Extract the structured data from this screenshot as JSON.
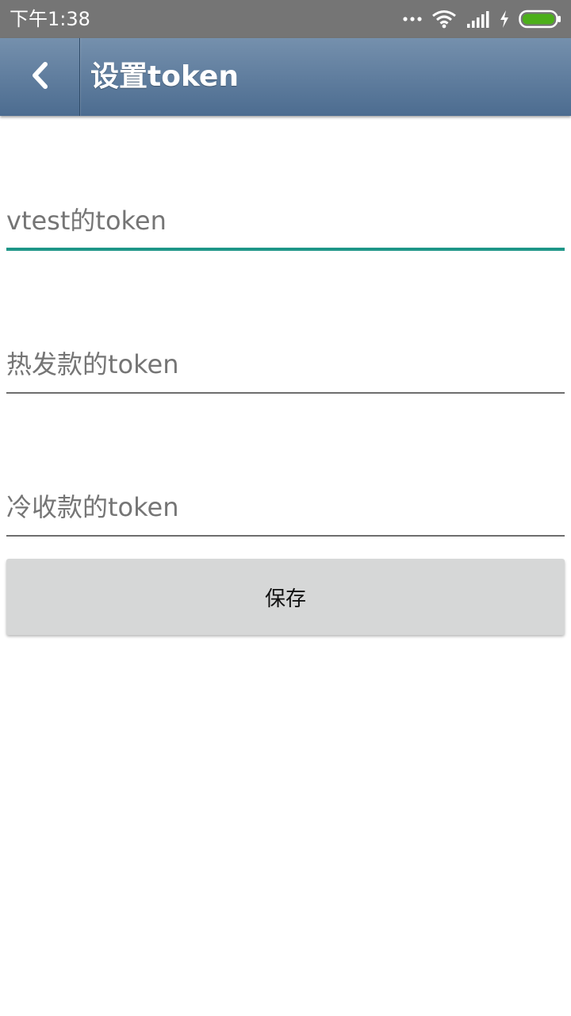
{
  "status_bar": {
    "time": "下午1:38",
    "icons": [
      "more-dots-icon",
      "wifi-icon",
      "signal-icon",
      "charging-icon",
      "battery-icon"
    ],
    "battery_color": "#4caf1a"
  },
  "app_bar": {
    "title": "设置token",
    "back_icon": "chevron-left-icon",
    "colors": {
      "top": "#7590ad",
      "bottom": "#4c6c90"
    }
  },
  "form": {
    "fields": [
      {
        "placeholder": "vtest的token",
        "value": "",
        "focused": true
      },
      {
        "placeholder": "热发款的token",
        "value": "",
        "focused": false
      },
      {
        "placeholder": "冷收款的token",
        "value": "",
        "focused": false
      }
    ],
    "save_label": "保存",
    "accent_color": "#1e9688"
  }
}
